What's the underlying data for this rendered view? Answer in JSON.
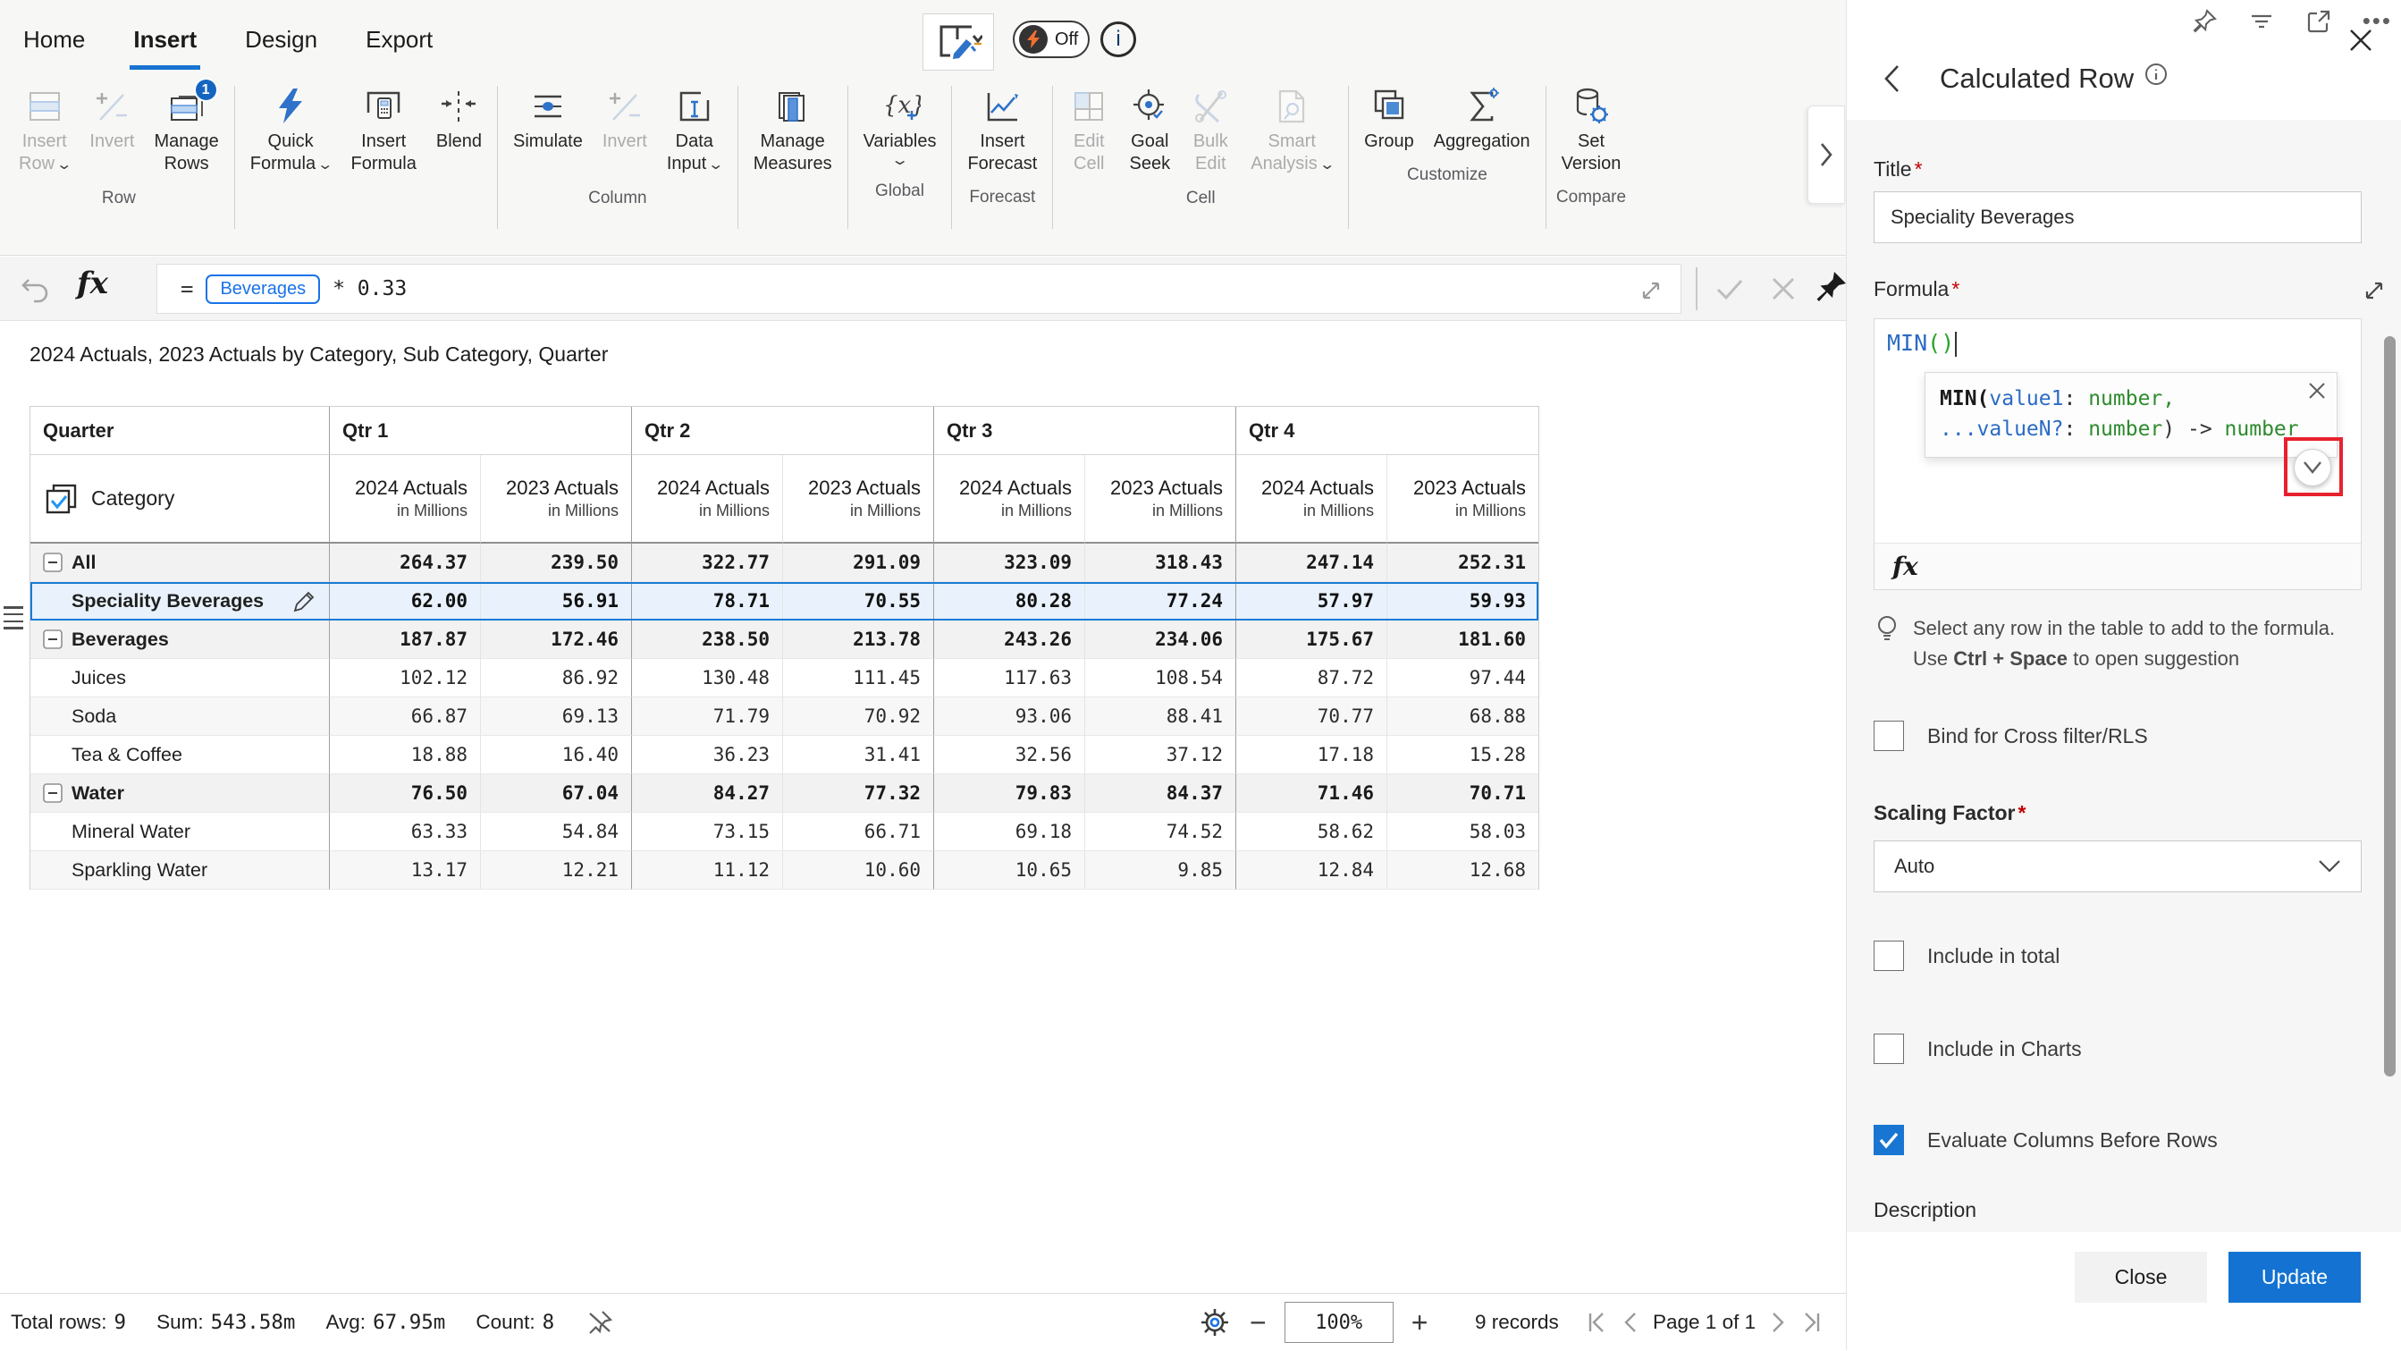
{
  "ribbon": {
    "tabs": [
      "Home",
      "Insert",
      "Design",
      "Export"
    ],
    "active_tab": "Insert",
    "group_labels": {
      "row": "Row",
      "column": "Column",
      "global": "Global",
      "forecast": "Forecast",
      "cell": "Cell",
      "customize": "Customize",
      "compare": "Compare"
    },
    "b": {
      "insert_row": {
        "l1": "Insert",
        "l2": "Row"
      },
      "invert_row": {
        "l1": "Invert"
      },
      "manage_rows": {
        "l1": "Manage",
        "l2": "Rows",
        "badge": "1"
      },
      "quick_formula": {
        "l1": "Quick",
        "l2": "Formula"
      },
      "insert_formula": {
        "l1": "Insert",
        "l2": "Formula"
      },
      "blend": {
        "l1": "Blend"
      },
      "simulate": {
        "l1": "Simulate"
      },
      "invert_col": {
        "l1": "Invert"
      },
      "data_input": {
        "l1": "Data",
        "l2": "Input"
      },
      "manage_measures": {
        "l1": "Manage",
        "l2": "Measures"
      },
      "variables": {
        "l1": "Variables"
      },
      "insert_forecast": {
        "l1": "Insert",
        "l2": "Forecast"
      },
      "edit_cell": {
        "l1": "Edit",
        "l2": "Cell"
      },
      "goal_seek": {
        "l1": "Goal",
        "l2": "Seek"
      },
      "bulk_edit": {
        "l1": "Bulk",
        "l2": "Edit"
      },
      "smart_analysis": {
        "l1": "Smart",
        "l2": "Analysis"
      },
      "group": {
        "l1": "Group"
      },
      "aggregation": {
        "l1": "Aggregation"
      },
      "set_version": {
        "l1": "Set",
        "l2": "Version"
      }
    },
    "toggle_off": "Off",
    "info": "i"
  },
  "formula_bar": {
    "equals": "=",
    "chip": "Beverages",
    "expr": "* 0.33"
  },
  "table": {
    "title": "2024 Actuals, 2023 Actuals by Category, Sub Category, Quarter",
    "corner": "Quarter",
    "row_dimension": "Category",
    "quarters": [
      "Qtr 1",
      "Qtr 2",
      "Qtr 3",
      "Qtr 4"
    ],
    "cols": [
      {
        "m": "2024 Actuals",
        "u": "in Millions"
      },
      {
        "m": "2023 Actuals",
        "u": "in Millions"
      },
      {
        "m": "2024 Actuals",
        "u": "in Millions"
      },
      {
        "m": "2023 Actuals",
        "u": "in Millions"
      },
      {
        "m": "2024 Actuals",
        "u": "in Millions"
      },
      {
        "m": "2023 Actuals",
        "u": "in Millions"
      },
      {
        "m": "2024 Actuals",
        "u": "in Millions"
      },
      {
        "m": "2023 Actuals",
        "u": "in Millions"
      }
    ],
    "rows": [
      {
        "label": "All",
        "parent": true,
        "values": [
          "264.37",
          "239.50",
          "322.77",
          "291.09",
          "323.09",
          "318.43",
          "247.14",
          "252.31"
        ]
      },
      {
        "label": "Speciality Beverages",
        "selected": true,
        "calculated": true,
        "values": [
          "62.00",
          "56.91",
          "78.71",
          "70.55",
          "80.28",
          "77.24",
          "57.97",
          "59.93"
        ]
      },
      {
        "label": "Beverages",
        "parent": true,
        "values": [
          "187.87",
          "172.46",
          "238.50",
          "213.78",
          "243.26",
          "234.06",
          "175.67",
          "181.60"
        ]
      },
      {
        "label": "Juices",
        "values": [
          "102.12",
          "86.92",
          "130.48",
          "111.45",
          "117.63",
          "108.54",
          "87.72",
          "97.44"
        ]
      },
      {
        "label": "Soda",
        "values": [
          "66.87",
          "69.13",
          "71.79",
          "70.92",
          "93.06",
          "88.41",
          "70.77",
          "68.88"
        ]
      },
      {
        "label": "Tea & Coffee",
        "values": [
          "18.88",
          "16.40",
          "36.23",
          "31.41",
          "32.56",
          "37.12",
          "17.18",
          "15.28"
        ]
      },
      {
        "label": "Water",
        "parent": true,
        "values": [
          "76.50",
          "67.04",
          "84.27",
          "77.32",
          "79.83",
          "84.37",
          "71.46",
          "70.71"
        ]
      },
      {
        "label": "Mineral Water",
        "values": [
          "63.33",
          "54.84",
          "73.15",
          "66.71",
          "69.18",
          "74.52",
          "58.62",
          "58.03"
        ]
      },
      {
        "label": "Sparkling Water",
        "values": [
          "13.17",
          "12.21",
          "11.12",
          "10.60",
          "10.65",
          "9.85",
          "12.84",
          "12.68"
        ]
      }
    ]
  },
  "status": {
    "total_rows_label": "Total rows:",
    "total_rows": "9",
    "sum_label": "Sum:",
    "sum": "543.58m",
    "avg_label": "Avg:",
    "avg": "67.95m",
    "count_label": "Count:",
    "count": "8",
    "zoom": "100%",
    "records": "9 records",
    "page": "Page 1 of 1"
  },
  "panel": {
    "title": "Calculated Row",
    "title_field": {
      "label": "Title",
      "required": "*",
      "value": "Speciality Beverages"
    },
    "formula_field": {
      "label": "Formula",
      "required": "*",
      "code_fn": "MIN",
      "code_paren": "()"
    },
    "tooltip": {
      "fn": "MIN(",
      "arg1": "value1",
      "sep1": ": ",
      "t1": "number,",
      "arg2": "...valueN?",
      "sep2": ": ",
      "t2": "number",
      "close": ") -> ",
      "ret": "number"
    },
    "fx": "fx",
    "tip": {
      "line1": "Select any row in the table to add to the formula.",
      "l2a": "Use ",
      "l2b": "Ctrl + Space",
      "l2c": " to open suggestion"
    },
    "checkboxes": {
      "bind": {
        "label": "Bind for Cross filter/RLS",
        "checked": false
      },
      "include_total": {
        "label": "Include in total",
        "checked": false
      },
      "include_charts": {
        "label": "Include in Charts",
        "checked": false
      },
      "evaluate": {
        "label": "Evaluate Columns Before Rows",
        "checked": true
      }
    },
    "scaling": {
      "label": "Scaling Factor",
      "required": "*",
      "value": "Auto"
    },
    "description_label": "Description",
    "close": "Close",
    "update": "Update",
    "accent_color": "#1473d2",
    "annotation_color": "#e8212e"
  }
}
